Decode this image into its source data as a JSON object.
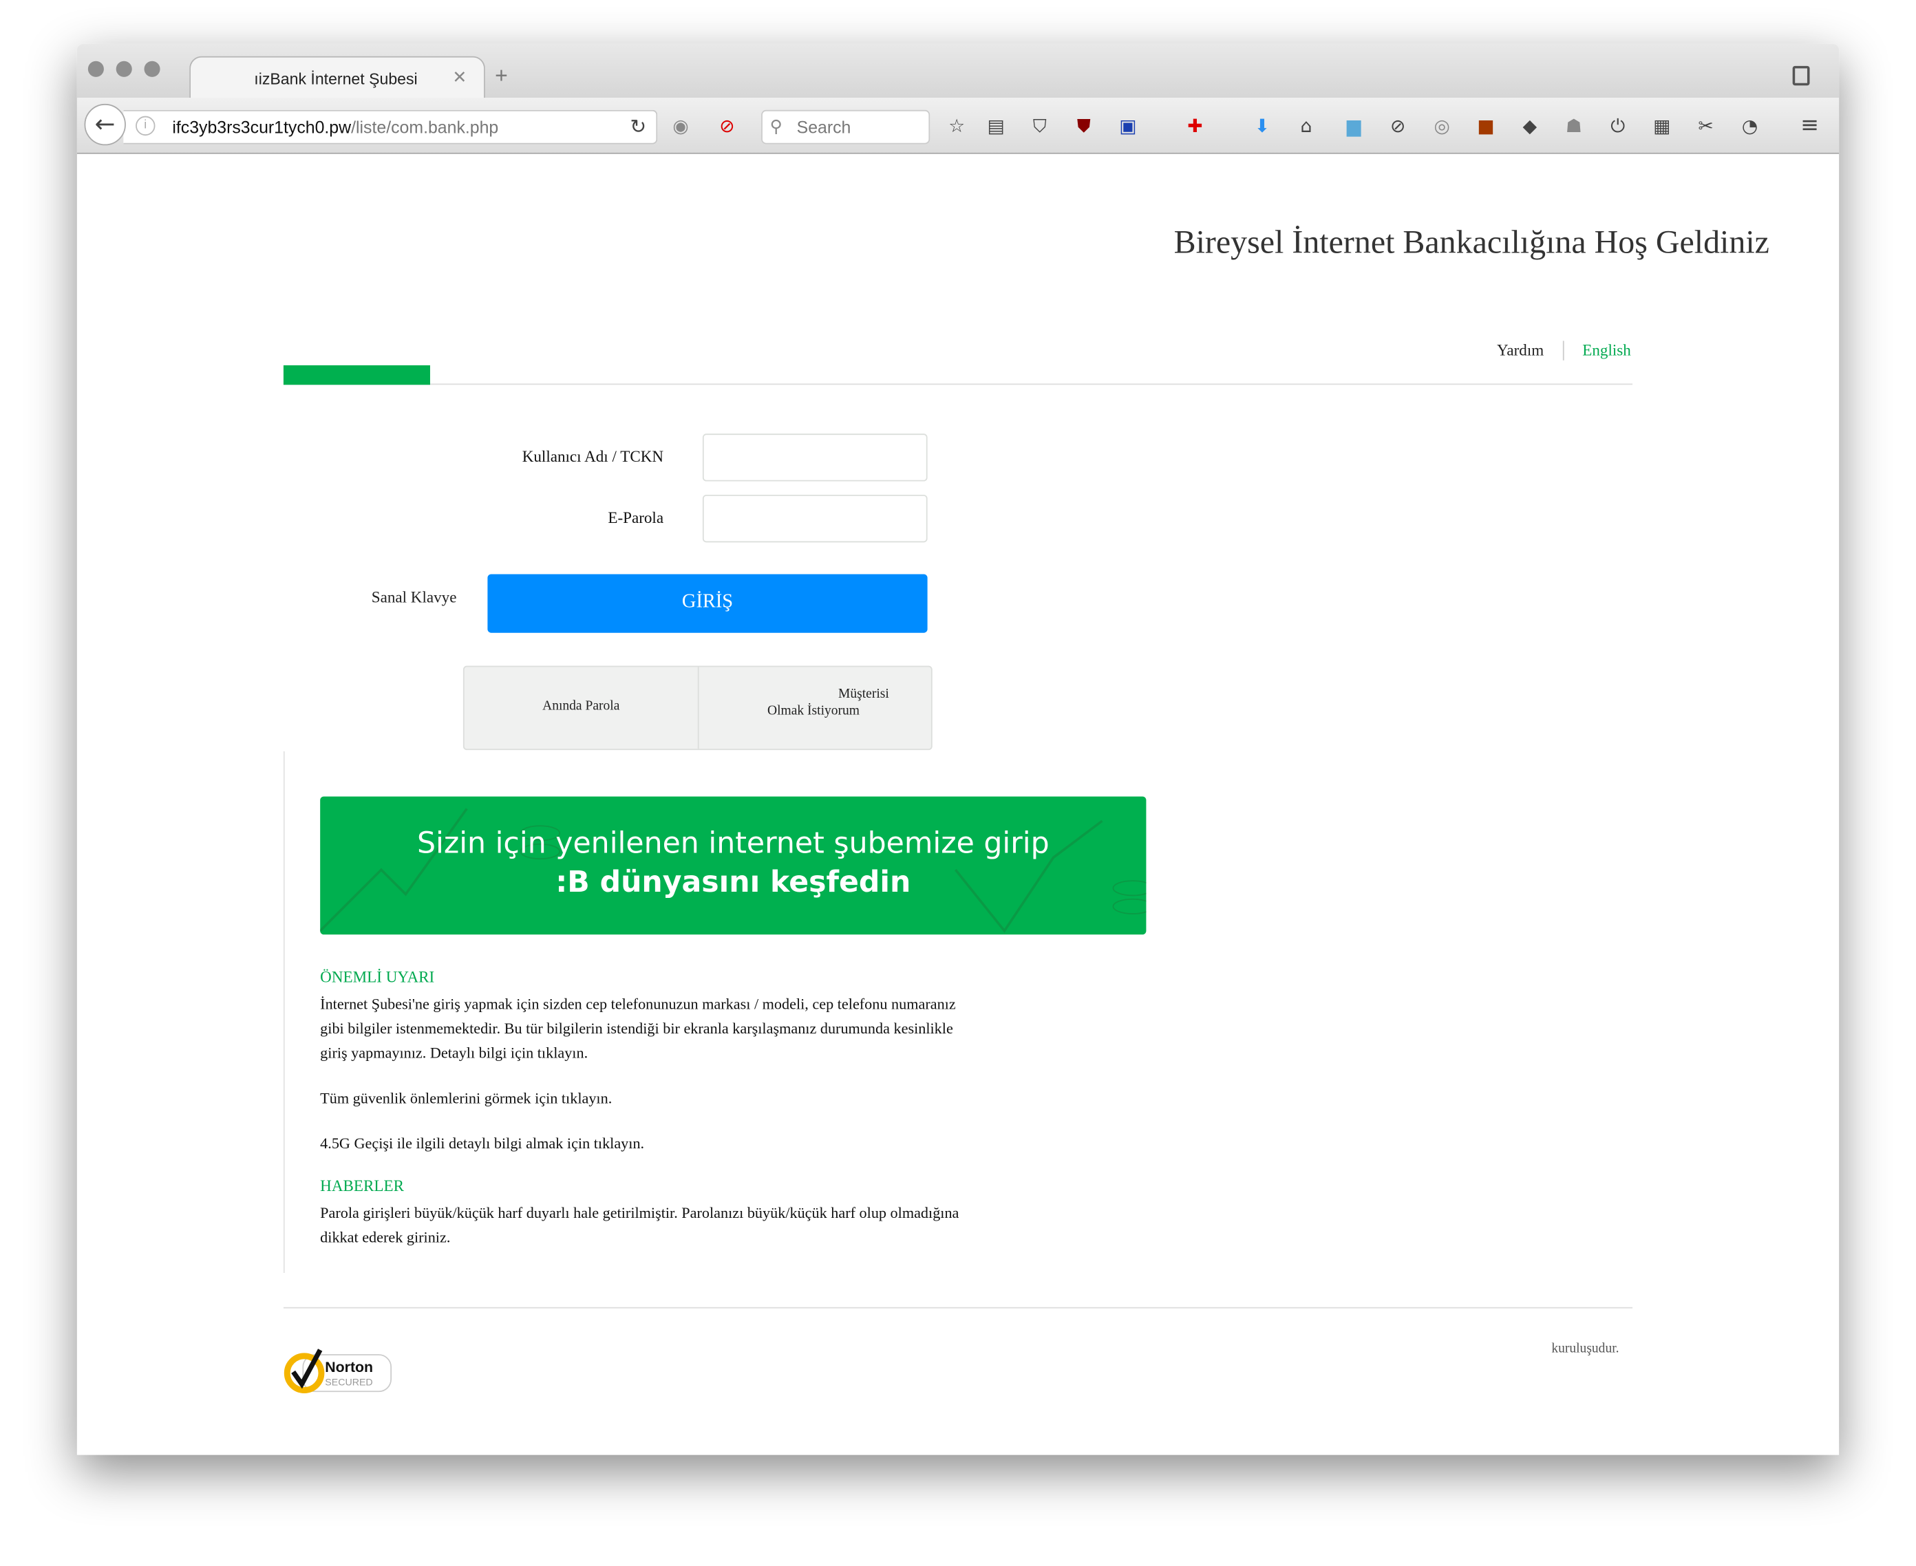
{
  "browser": {
    "tab_title": "ıizBank İnternet Şubesi",
    "url_host": "ifc3yb3rs3cur1tych0.pw",
    "url_path": "/liste/com.bank.php",
    "search_placeholder": "Search",
    "toolbar_icons": [
      "bookmark-star-icon",
      "reading-list-icon",
      "pocket-icon",
      "ublock-icon",
      "save-icon",
      "first-aid-icon",
      "download-icon",
      "home-icon",
      "skype-icon",
      "no-script-icon",
      "vpn-icon",
      "extension-icon",
      "pin-icon",
      "ghostery-icon",
      "power-icon",
      "add-grid-icon",
      "screenshot-icon",
      "history-icon",
      "menu-icon"
    ]
  },
  "header": {
    "title": "Bireysel İnternet Bankacılığına Hoş Geldiniz",
    "help": "Yardım",
    "language": "English"
  },
  "login": {
    "username_label": "Kullanıcı Adı / TCKN",
    "password_label": "E-Parola",
    "virtual_keyboard": "Sanal Klavye",
    "submit": "GİRİŞ"
  },
  "links": {
    "instant_password": "Anında Parola",
    "become_customer_line1": "Müşterisi",
    "become_customer_line2": "Olmak İstiyorum"
  },
  "banner": {
    "line1": "Sizin için yenilenen internet şubemize girip",
    "line2": ":B dünyasını keşfedin"
  },
  "notice": {
    "title": "ÖNEMLİ UYARI",
    "lines": [
      "İnternet Şubesi'ne giriş yapmak için sizden cep telefonunuzun markası / modeli, cep telefonu numaranız",
      "gibi bilgiler istenmemektedir. Bu tür bilgilerin istendiği bir ekranla karşılaşmanız durumunda kesinlikle",
      "giriş yapmayınız. Detaylı bilgi için tıklayın."
    ],
    "security": "Tüm güvenlik önlemlerini görmek için tıklayın.",
    "lte": "4.5G Geçişi ile ilgili detaylı bilgi almak için tıklayın."
  },
  "news": {
    "title": "HABERLER",
    "lines": [
      "Parola girişleri büyük/küçük harf duyarlı hale getirilmiştir. Parolanızı büyük/küçük harf olup olmadığına",
      "dikkat ederek giriniz."
    ]
  },
  "footer": {
    "badge": "Norton SECURED",
    "note": "kuruluşudur."
  },
  "colors": {
    "accent_green": "#00a94f",
    "banner_green": "#00b04f",
    "button_blue": "#008cff"
  }
}
